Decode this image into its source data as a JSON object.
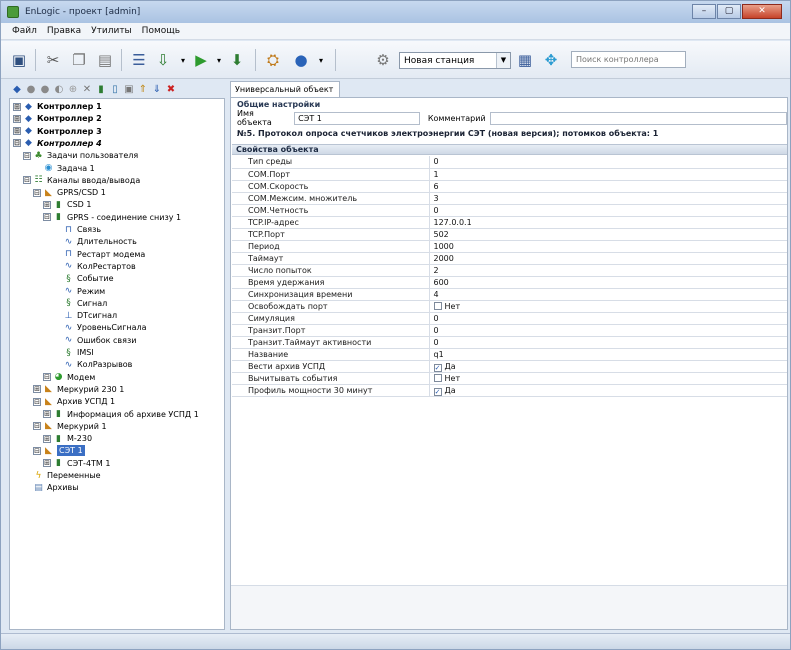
{
  "window": {
    "title": "EnLogic - проект [admin]",
    "controls": {
      "minimize": "–",
      "maximize": "▢",
      "close": "✕"
    }
  },
  "menu": [
    "Файл",
    "Правка",
    "Утилиты",
    "Помощь"
  ],
  "toolbar": {
    "station_select": "Новая станция",
    "search_placeholder": "Поиск контроллера"
  },
  "tree": [
    {
      "label": "Контроллер 1",
      "level": 0,
      "exp": "⊞",
      "icon": "controller-icon",
      "style": "bold"
    },
    {
      "label": "Контроллер 2",
      "level": 0,
      "exp": "⊞",
      "icon": "controller-icon",
      "style": "bold"
    },
    {
      "label": "Контроллер 3",
      "level": 0,
      "exp": "⊞",
      "icon": "controller-icon",
      "style": "bold"
    },
    {
      "label": "Контроллер 4",
      "level": 0,
      "exp": "⊟",
      "icon": "controller-icon",
      "style": "bold-italic"
    },
    {
      "label": "Задачи пользователя",
      "level": 1,
      "exp": "⊟",
      "icon": "tasks-icon"
    },
    {
      "label": "Задача 1",
      "level": 2,
      "exp": "",
      "icon": "task-icon"
    },
    {
      "label": "Каналы ввода/вывода",
      "level": 1,
      "exp": "⊟",
      "icon": "channels-icon"
    },
    {
      "label": "GPRS/CSD 1",
      "level": 2,
      "exp": "⊟",
      "icon": "device-icon"
    },
    {
      "label": "CSD 1",
      "level": 3,
      "exp": "⊞",
      "icon": "module-icon"
    },
    {
      "label": "GPRS - соединение снизу 1",
      "level": 3,
      "exp": "⊟",
      "icon": "module-icon"
    },
    {
      "label": "Связь",
      "level": 4,
      "exp": "",
      "icon": "signal-icon"
    },
    {
      "label": "Длительность",
      "level": 4,
      "exp": "",
      "icon": "wave-icon"
    },
    {
      "label": "Рестарт модема",
      "level": 4,
      "exp": "",
      "icon": "signal-icon"
    },
    {
      "label": "КолРестартов",
      "level": 4,
      "exp": "",
      "icon": "wave-icon"
    },
    {
      "label": "Событие",
      "level": 4,
      "exp": "",
      "icon": "str-icon"
    },
    {
      "label": "Режим",
      "level": 4,
      "exp": "",
      "icon": "wave-icon"
    },
    {
      "label": "Сигнал",
      "level": 4,
      "exp": "",
      "icon": "str-icon"
    },
    {
      "label": "DTсигнал",
      "level": 4,
      "exp": "",
      "icon": "dt-icon"
    },
    {
      "label": "УровеньСигнала",
      "level": 4,
      "exp": "",
      "icon": "wave-icon"
    },
    {
      "label": "Ошибок связи",
      "level": 4,
      "exp": "",
      "icon": "wave-icon"
    },
    {
      "label": "IMSI",
      "level": 4,
      "exp": "",
      "icon": "str-icon"
    },
    {
      "label": "КолРазрывов",
      "level": 4,
      "exp": "",
      "icon": "wave-icon"
    },
    {
      "label": "Модем",
      "level": 3,
      "exp": "⊟",
      "icon": "modem-icon"
    },
    {
      "label": "Меркурий 230 1",
      "level": 2,
      "exp": "⊞",
      "icon": "device-icon"
    },
    {
      "label": "Архив УСПД 1",
      "level": 2,
      "exp": "⊟",
      "icon": "device-icon"
    },
    {
      "label": "Информация об архиве УСПД 1",
      "level": 3,
      "exp": "⊞",
      "icon": "module-icon"
    },
    {
      "label": "Меркурий 1",
      "level": 2,
      "exp": "⊟",
      "icon": "device-icon"
    },
    {
      "label": "M-230",
      "level": 3,
      "exp": "⊞",
      "icon": "module-icon"
    },
    {
      "label": "СЭТ 1",
      "level": 2,
      "exp": "⊟",
      "icon": "device-icon",
      "selected": true
    },
    {
      "label": "СЭТ-4ТМ 1",
      "level": 3,
      "exp": "⊞",
      "icon": "module-icon"
    },
    {
      "label": "Переменные",
      "level": 1,
      "exp": "",
      "icon": "variables-icon"
    },
    {
      "label": "Архивы",
      "level": 1,
      "exp": "",
      "icon": "archives-icon"
    }
  ],
  "tab": {
    "label": "Универсальный объект"
  },
  "general": {
    "header": "Общие настройки",
    "name_label": "Имя объекта",
    "name_value": "СЭТ 1",
    "comment_label": "Комментарий",
    "comment_value": "",
    "description": "№5. Протокол опроса счетчиков электроэнергии СЭТ (новая версия); потомков объекта: 1"
  },
  "properties": {
    "header": "Свойства объекта",
    "rows": [
      {
        "name": "Тип среды",
        "value": "0"
      },
      {
        "name": "COM.Порт",
        "value": "1"
      },
      {
        "name": "COM.Скорость",
        "value": "6"
      },
      {
        "name": "COM.Межсим. множитель",
        "value": "3"
      },
      {
        "name": "COM.Четность",
        "value": "0"
      },
      {
        "name": "TCP.IP-адрес",
        "value": "127.0.0.1"
      },
      {
        "name": "TCP.Порт",
        "value": "502"
      },
      {
        "name": "Период",
        "value": "1000"
      },
      {
        "name": "Таймаут",
        "value": "2000"
      },
      {
        "name": "Число попыток",
        "value": "2"
      },
      {
        "name": "Время удержания",
        "value": "600"
      },
      {
        "name": "Синхронизация времени",
        "value": "4"
      },
      {
        "name": "Освобождать порт",
        "value": "Нет",
        "checkbox": false
      },
      {
        "name": "Симуляция",
        "value": "0"
      },
      {
        "name": "Транзит.Порт",
        "value": "0"
      },
      {
        "name": "Транзит.Таймаут активности",
        "value": "0"
      },
      {
        "name": "Название",
        "value": "q1"
      },
      {
        "name": "Вести архив УСПД",
        "value": "Да",
        "checkbox": true
      },
      {
        "name": "Вычитывать события",
        "value": "Нет",
        "checkbox": false
      },
      {
        "name": "Профиль мощности 30 минут",
        "value": "Да",
        "checkbox": true
      }
    ]
  }
}
